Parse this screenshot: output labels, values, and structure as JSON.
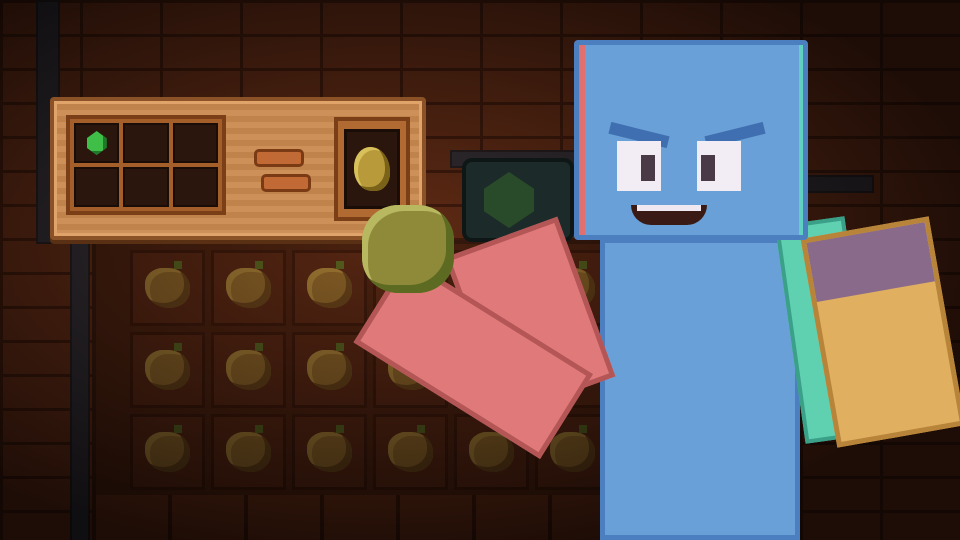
{
  "scene": {
    "type": "minecraft-style crafting scene",
    "palette": {
      "wall": "#5a2814",
      "panel_wood": "#c98a4f",
      "character_blue": "#6aa0d8",
      "sleeve_red": "#e07a7a",
      "emerald_green": "#3fbf48"
    }
  },
  "crafting_panel": {
    "grid": {
      "rows": 2,
      "cols": 3,
      "slots": [
        {
          "item": "emerald-icon"
        },
        {
          "item": ""
        },
        {
          "item": ""
        },
        {
          "item": ""
        },
        {
          "item": ""
        },
        {
          "item": ""
        }
      ]
    },
    "result": {
      "item": "potato-icon"
    }
  },
  "crop_field": {
    "rows": 3,
    "cols": 6,
    "crop": "potato-icon"
  },
  "character": {
    "held_item": "potato-icon"
  }
}
